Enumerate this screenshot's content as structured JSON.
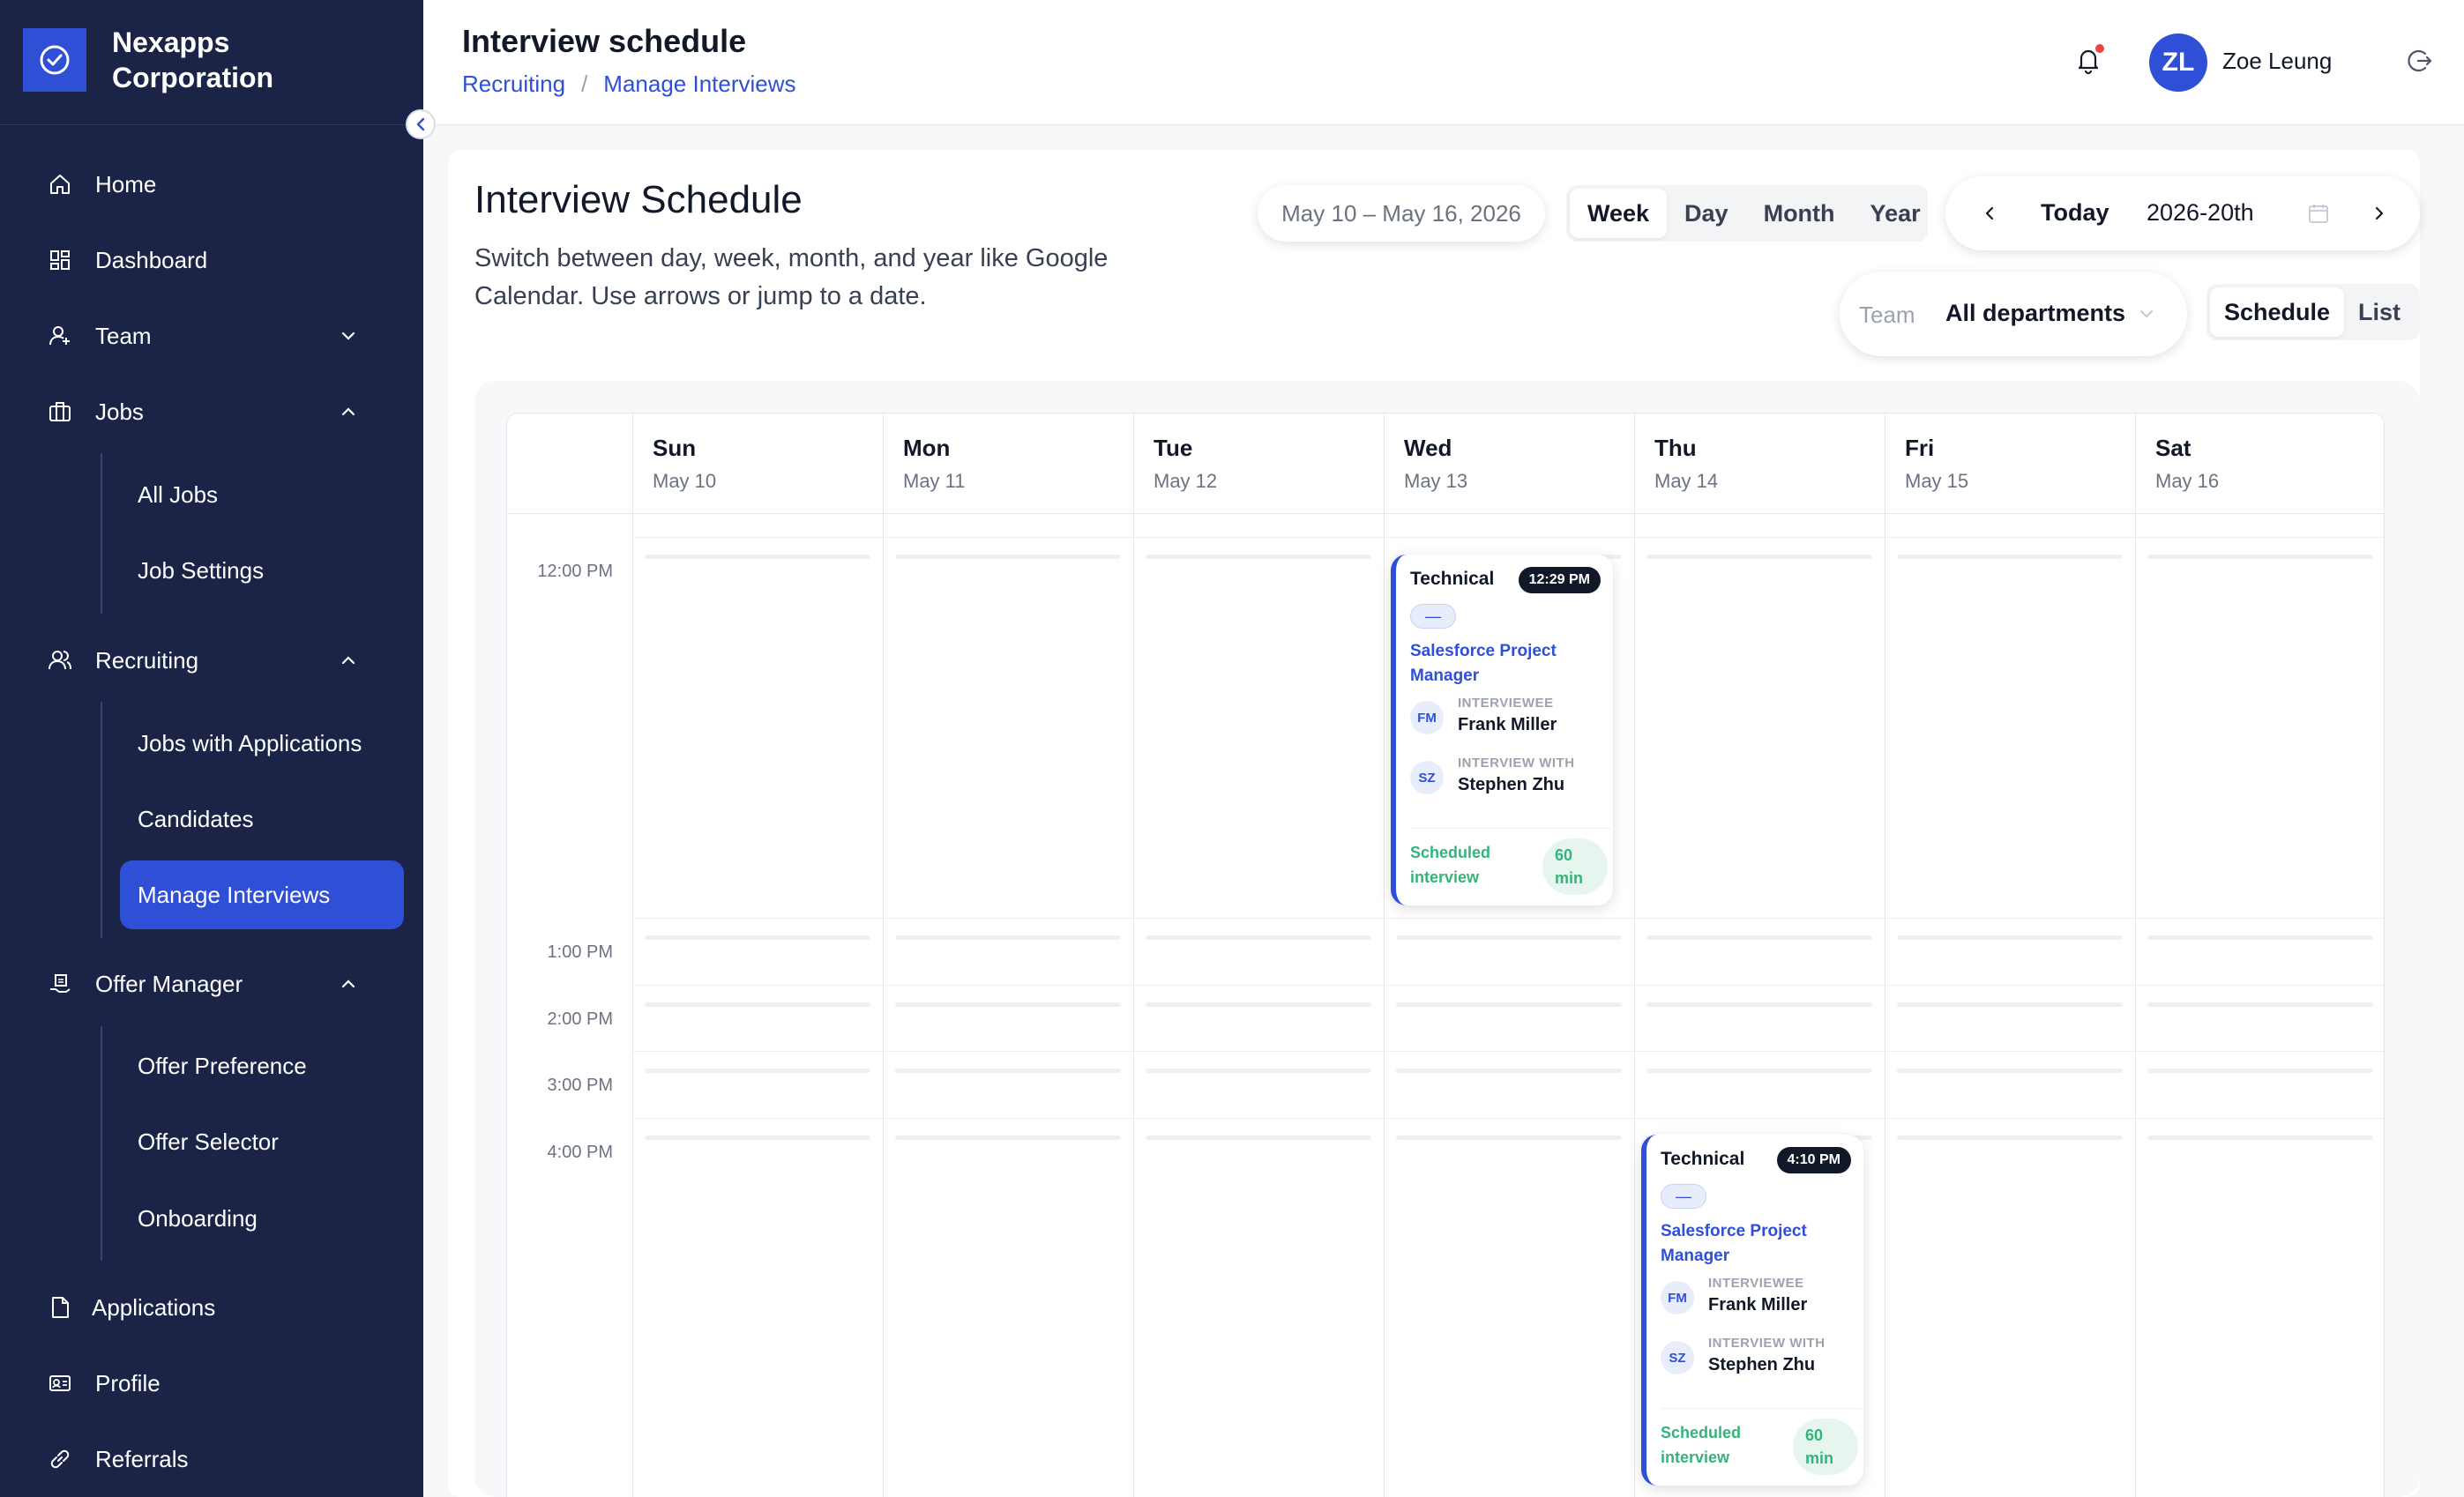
{
  "brand": {
    "name_line1": "Nexapps",
    "name_line2": "Corporation"
  },
  "sidebar": {
    "items": [
      {
        "label": "Home",
        "icon": "home-icon"
      },
      {
        "label": "Dashboard",
        "icon": "dashboard-icon"
      },
      {
        "label": "Team",
        "icon": "team-icon"
      },
      {
        "label": "Jobs",
        "icon": "briefcase-icon"
      },
      {
        "label": "Recruiting",
        "icon": "users-icon"
      },
      {
        "label": "Offer Manager",
        "icon": "offer-icon"
      },
      {
        "label": "Applications",
        "icon": "document-icon"
      },
      {
        "label": "Profile",
        "icon": "id-card-icon"
      },
      {
        "label": "Referrals",
        "icon": "link-icon"
      }
    ],
    "jobs_sub": [
      "All Jobs",
      "Job Settings"
    ],
    "recruiting_sub": [
      "Jobs with Applications",
      "Candidates",
      "Manage Interviews"
    ],
    "offer_sub": [
      "Offer Preference",
      "Offer Selector",
      "Onboarding"
    ],
    "active_item": "Manage Interviews"
  },
  "header": {
    "title": "Interview schedule",
    "breadcrumb": [
      "Recruiting",
      "Manage Interviews"
    ],
    "breadcrumb_sep": "/",
    "user_initials": "ZL",
    "user_name": "Zoe Leung"
  },
  "main": {
    "heading": "Interview Schedule",
    "subtitle": "Switch between day, week, month, and year like Google Calendar. Use arrows or jump to a date.",
    "date_range": "May 10 – May 16, 2026",
    "views": [
      "Week",
      "Day",
      "Month",
      "Year"
    ],
    "active_view": "Week",
    "today_label": "Today",
    "week_value": "2026-20th",
    "team_label": "Team",
    "team_value": "All departments",
    "modes": [
      "Schedule",
      "List"
    ],
    "active_mode": "Schedule"
  },
  "calendar": {
    "days": [
      {
        "name": "Sun",
        "date": "May 10"
      },
      {
        "name": "Mon",
        "date": "May 11"
      },
      {
        "name": "Tue",
        "date": "May 12"
      },
      {
        "name": "Wed",
        "date": "May 13"
      },
      {
        "name": "Thu",
        "date": "May 14"
      },
      {
        "name": "Fri",
        "date": "May 15"
      },
      {
        "name": "Sat",
        "date": "May 16"
      }
    ],
    "time_labels": [
      "12:00 PM",
      "1:00 PM",
      "2:00 PM",
      "3:00 PM",
      "4:00 PM"
    ],
    "events": [
      {
        "day": "Wed",
        "type": "Technical",
        "time": "12:29 PM",
        "tag": "—",
        "job": "Salesforce Project Manager",
        "interviewee_role": "INTERVIEWEE",
        "interviewee_initials": "FM",
        "interviewee_name": "Frank Miller",
        "interviewer_role": "INTERVIEW WITH",
        "interviewer_initials": "SZ",
        "interviewer_name": "Stephen Zhu",
        "status": "Scheduled interview",
        "duration": "60 min"
      },
      {
        "day": "Thu",
        "type": "Technical",
        "time": "4:10 PM",
        "tag": "—",
        "job": "Salesforce Project Manager",
        "interviewee_role": "INTERVIEWEE",
        "interviewee_initials": "FM",
        "interviewee_name": "Frank Miller",
        "interviewer_role": "INTERVIEW WITH",
        "interviewer_initials": "SZ",
        "interviewer_name": "Stephen Zhu",
        "status": "Scheduled interview",
        "duration": "60 min"
      }
    ]
  },
  "colors": {
    "sidebar_bg": "#1b2447",
    "accent": "#2f4fd6",
    "success": "#34b37a",
    "notification": "#ef4444"
  }
}
